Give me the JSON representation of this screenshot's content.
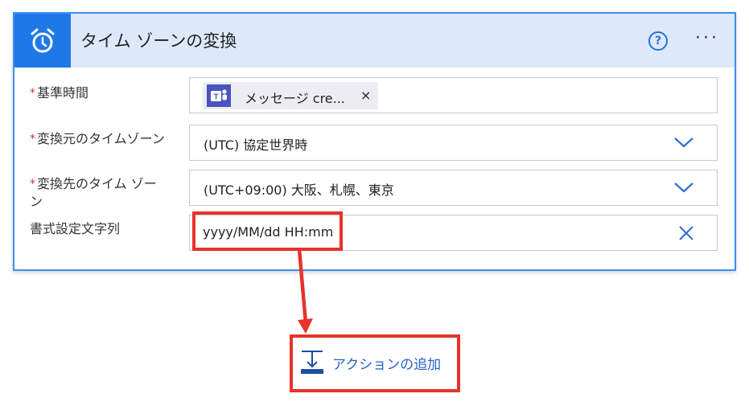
{
  "card": {
    "title": "タイム ゾーンの変換",
    "help_label": "?",
    "more_label": "···"
  },
  "fields": {
    "base_time": {
      "required": "*",
      "label": "基準時間",
      "token_text": "メッセージ cre...",
      "token_close": "×"
    },
    "source_tz": {
      "required": "*",
      "label": "変換元のタイムゾーン",
      "value": "(UTC) 協定世界時"
    },
    "dest_tz": {
      "required": "*",
      "label_line1": "変換先のタイム ゾー",
      "label_line2": "ン",
      "value": "(UTC+09:00) 大阪、札幌、東京"
    },
    "format": {
      "label": "書式設定文字列",
      "value": "yyyy/MM/dd HH:mm"
    }
  },
  "add_action": {
    "label": "アクションの追加"
  },
  "colors": {
    "accent": "#1f78e8",
    "header_bg": "#dde9fb",
    "highlight": "#e8322b",
    "link": "#2563c9"
  }
}
